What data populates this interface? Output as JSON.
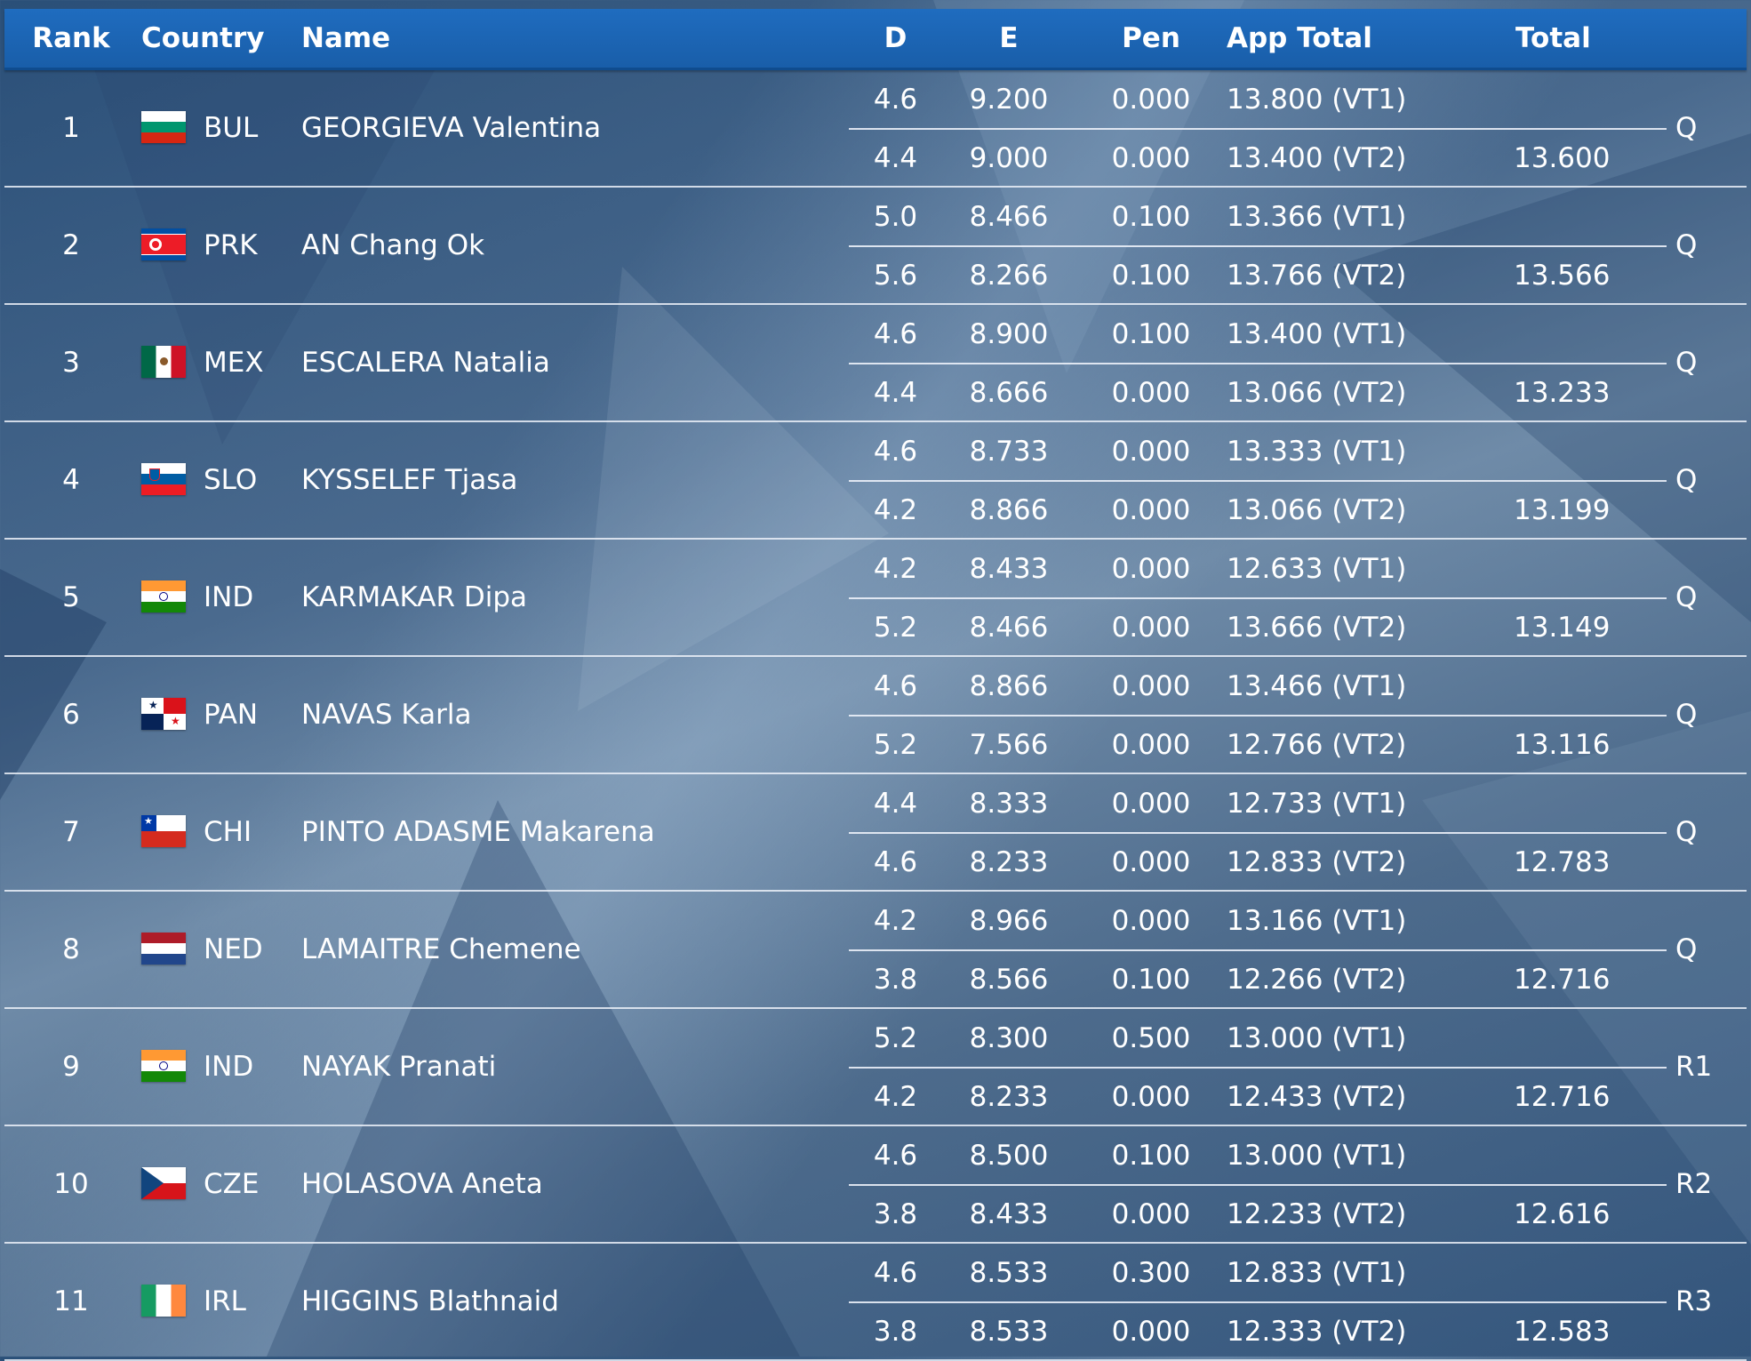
{
  "columns": {
    "rank": "Rank",
    "country": "Country",
    "name": "Name",
    "d": "D",
    "e": "E",
    "pen": "Pen",
    "app_total": "App Total",
    "total": "Total"
  },
  "rows": [
    {
      "rank": "1",
      "flag": "BUL",
      "country": "BUL",
      "name": "GEORGIEVA Valentina",
      "status": "Q",
      "total": "13.600",
      "v1": {
        "d": "4.6",
        "e": "9.200",
        "pen": "0.000",
        "app": "13.800 (VT1)"
      },
      "v2": {
        "d": "4.4",
        "e": "9.000",
        "pen": "0.000",
        "app": "13.400 (VT2)"
      }
    },
    {
      "rank": "2",
      "flag": "PRK",
      "country": "PRK",
      "name": "AN Chang Ok",
      "status": "Q",
      "total": "13.566",
      "v1": {
        "d": "5.0",
        "e": "8.466",
        "pen": "0.100",
        "app": "13.366 (VT1)"
      },
      "v2": {
        "d": "5.6",
        "e": "8.266",
        "pen": "0.100",
        "app": "13.766 (VT2)"
      }
    },
    {
      "rank": "3",
      "flag": "MEX",
      "country": "MEX",
      "name": "ESCALERA Natalia",
      "status": "Q",
      "total": "13.233",
      "v1": {
        "d": "4.6",
        "e": "8.900",
        "pen": "0.100",
        "app": "13.400 (VT1)"
      },
      "v2": {
        "d": "4.4",
        "e": "8.666",
        "pen": "0.000",
        "app": "13.066 (VT2)"
      }
    },
    {
      "rank": "4",
      "flag": "SLO",
      "country": "SLO",
      "name": "KYSSELEF Tjasa",
      "status": "Q",
      "total": "13.199",
      "v1": {
        "d": "4.6",
        "e": "8.733",
        "pen": "0.000",
        "app": "13.333 (VT1)"
      },
      "v2": {
        "d": "4.2",
        "e": "8.866",
        "pen": "0.000",
        "app": "13.066 (VT2)"
      }
    },
    {
      "rank": "5",
      "flag": "IND",
      "country": "IND",
      "name": "KARMAKAR Dipa",
      "status": "Q",
      "total": "13.149",
      "v1": {
        "d": "4.2",
        "e": "8.433",
        "pen": "0.000",
        "app": "12.633 (VT1)"
      },
      "v2": {
        "d": "5.2",
        "e": "8.466",
        "pen": "0.000",
        "app": "13.666 (VT2)"
      }
    },
    {
      "rank": "6",
      "flag": "PAN",
      "country": "PAN",
      "name": "NAVAS Karla",
      "status": "Q",
      "total": "13.116",
      "v1": {
        "d": "4.6",
        "e": "8.866",
        "pen": "0.000",
        "app": "13.466 (VT1)"
      },
      "v2": {
        "d": "5.2",
        "e": "7.566",
        "pen": "0.000",
        "app": "12.766 (VT2)"
      }
    },
    {
      "rank": "7",
      "flag": "CHI",
      "country": "CHI",
      "name": "PINTO ADASME Makarena",
      "status": "Q",
      "total": "12.783",
      "v1": {
        "d": "4.4",
        "e": "8.333",
        "pen": "0.000",
        "app": "12.733 (VT1)"
      },
      "v2": {
        "d": "4.6",
        "e": "8.233",
        "pen": "0.000",
        "app": "12.833 (VT2)"
      }
    },
    {
      "rank": "8",
      "flag": "NED",
      "country": "NED",
      "name": "LAMAITRE Chemene",
      "status": "Q",
      "total": "12.716",
      "v1": {
        "d": "4.2",
        "e": "8.966",
        "pen": "0.000",
        "app": "13.166 (VT1)"
      },
      "v2": {
        "d": "3.8",
        "e": "8.566",
        "pen": "0.100",
        "app": "12.266 (VT2)"
      }
    },
    {
      "rank": "9",
      "flag": "IND",
      "country": "IND",
      "name": "NAYAK Pranati",
      "status": "R1",
      "total": "12.716",
      "v1": {
        "d": "5.2",
        "e": "8.300",
        "pen": "0.500",
        "app": "13.000 (VT1)"
      },
      "v2": {
        "d": "4.2",
        "e": "8.233",
        "pen": "0.000",
        "app": "12.433 (VT2)"
      }
    },
    {
      "rank": "10",
      "flag": "CZE",
      "country": "CZE",
      "name": "HOLASOVA Aneta",
      "status": "R2",
      "total": "12.616",
      "v1": {
        "d": "4.6",
        "e": "8.500",
        "pen": "0.100",
        "app": "13.000 (VT1)"
      },
      "v2": {
        "d": "3.8",
        "e": "8.433",
        "pen": "0.000",
        "app": "12.233 (VT2)"
      }
    },
    {
      "rank": "11",
      "flag": "IRL",
      "country": "IRL",
      "name": "HIGGINS Blathnaid",
      "status": "R3",
      "total": "12.583",
      "v1": {
        "d": "4.6",
        "e": "8.533",
        "pen": "0.300",
        "app": "12.833 (VT1)"
      },
      "v2": {
        "d": "3.8",
        "e": "8.533",
        "pen": "0.000",
        "app": "12.333 (VT2)"
      }
    }
  ],
  "colors": {
    "header_blue": "#1f6cbf",
    "text": "#ffffff",
    "divider": "#ebf0f8"
  }
}
